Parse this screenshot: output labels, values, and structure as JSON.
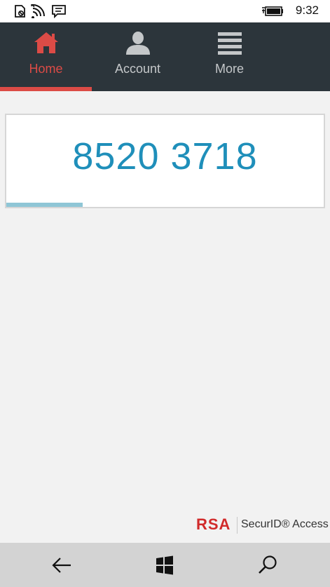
{
  "status_bar": {
    "time": "9:32",
    "icons": [
      "notification-icon",
      "wifi-icon",
      "message-icon",
      "battery-icon"
    ]
  },
  "nav": {
    "tabs": [
      {
        "label": "Home",
        "icon": "home-icon",
        "active": true
      },
      {
        "label": "Account",
        "icon": "person-icon",
        "active": false
      },
      {
        "label": "More",
        "icon": "menu-icon",
        "active": false
      }
    ]
  },
  "token": {
    "code": "8520 3718",
    "time_remaining_fraction": 0.24
  },
  "branding": {
    "logo": "RSA",
    "product": "SecurID® Access"
  },
  "bottom_bar": {
    "buttons": [
      "back-icon",
      "windows-start-icon",
      "search-icon"
    ]
  },
  "colors": {
    "accent": "#dc4b46",
    "nav_background": "#2c353b",
    "code": "#1f8fba",
    "progress": "#8fc6d6",
    "page_background": "#f2f2f2"
  }
}
